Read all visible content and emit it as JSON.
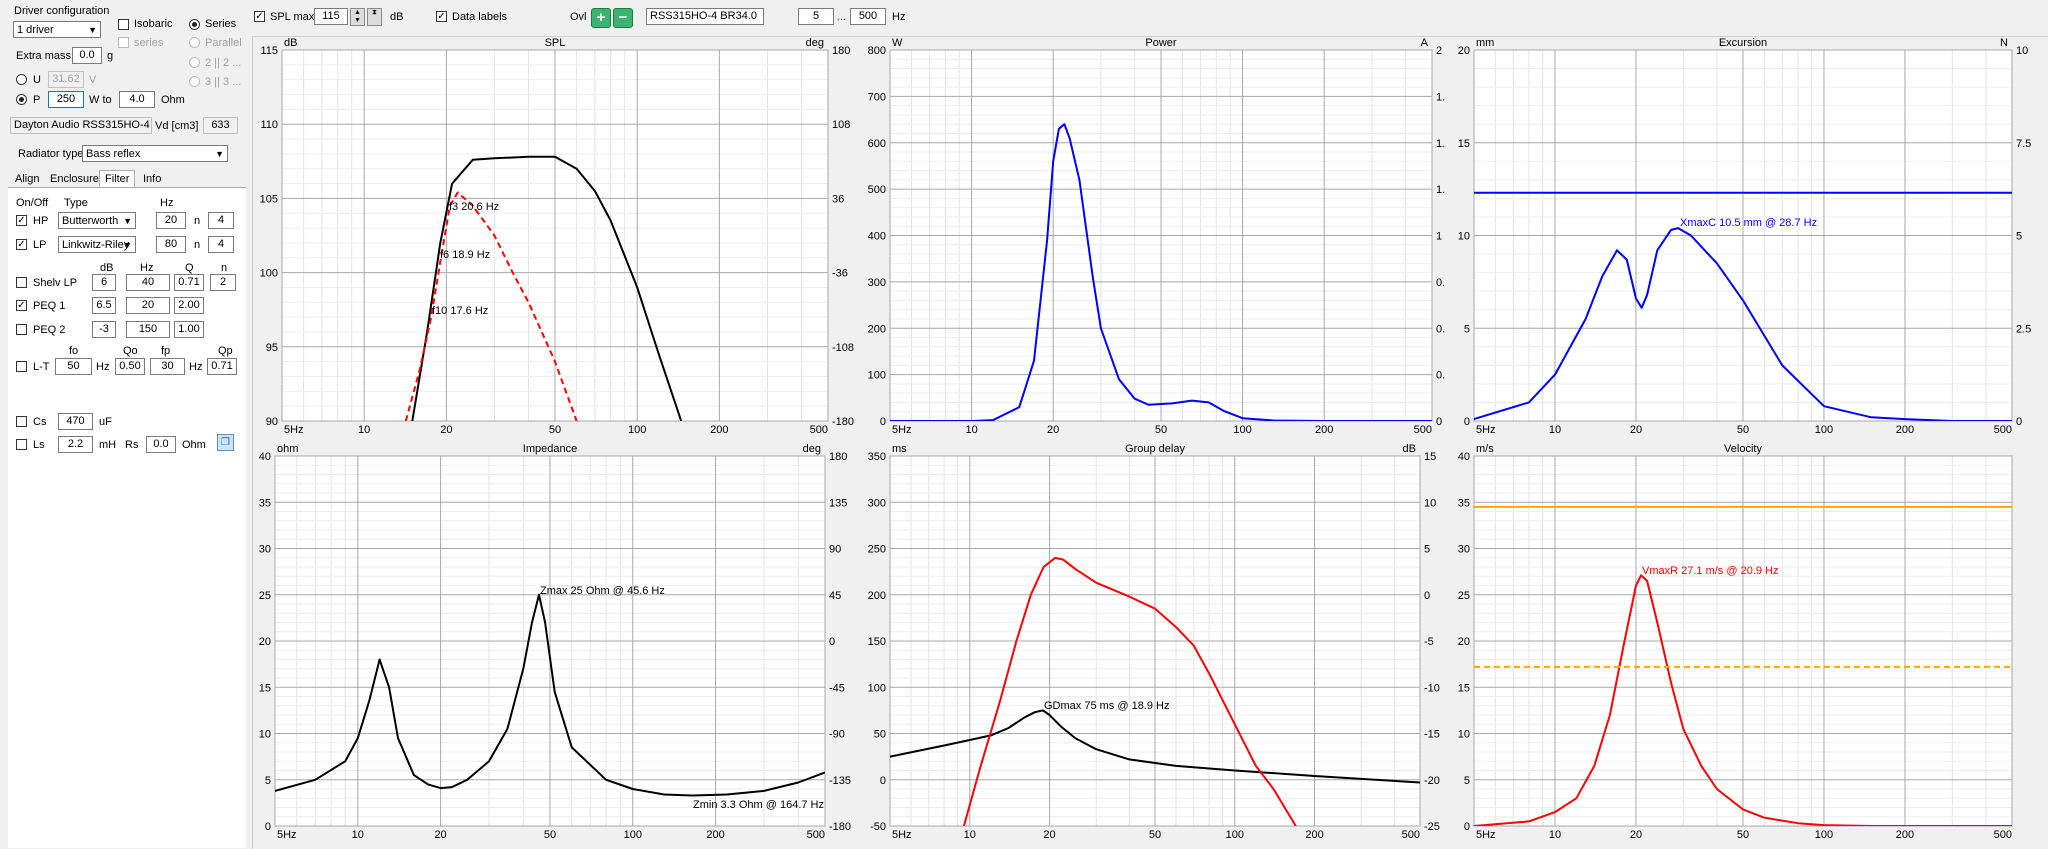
{
  "left_panel": {
    "driver_config_title": "Driver configuration",
    "driver_count": "1 driver",
    "isobaric": "Isobaric",
    "series": "Series",
    "series_small": "series",
    "parallel": "Parallel",
    "par1": "2 || 2 ...",
    "par2": "3 || 3 ...",
    "extra_mass_label": "Extra mass",
    "extra_mass": "0.0",
    "extra_mass_unit": "g",
    "u_label": "U",
    "u_value": "31.62",
    "u_unit": "V",
    "p_label": "P",
    "p_value": "250",
    "w_to": "W to",
    "ohm_value": "4.0",
    "ohm_unit": "Ohm",
    "driver_name": "Dayton Audio RSS315HO-4",
    "vd_label": "Vd [cm3]",
    "vd_value": "633",
    "radiator_label": "Radiator type",
    "radiator_value": "Bass reflex",
    "tabs": [
      "Align",
      "Enclosure",
      "Filter",
      "Info"
    ],
    "filter": {
      "onoff": "On/Off",
      "type": "Type",
      "hz": "Hz",
      "hp_label": "HP",
      "hp_type": "Butterworth",
      "hp_hz": "20",
      "hp_n_label": "n",
      "hp_n": "4",
      "lp_label": "LP",
      "lp_type": "Linkwitz-Riley",
      "lp_hz": "80",
      "lp_n_label": "n",
      "lp_n": "4",
      "db_head": "dB",
      "hz_head": "Hz",
      "q_head": "Q",
      "n_head": "n",
      "shelv_label": "Shelv LP",
      "shelv_db": "6",
      "shelv_hz": "40",
      "shelv_q": "0.71",
      "shelv_n": "2",
      "peq1_label": "PEQ 1",
      "peq1_db": "6.5",
      "peq1_hz": "20",
      "peq1_q": "2.00",
      "peq2_label": "PEQ 2",
      "peq2_db": "-3",
      "peq2_hz": "150",
      "peq2_q": "1.00",
      "fo": "fo",
      "qo": "Qo",
      "fp": "fp",
      "qp": "Qp",
      "lt_label": "L-T",
      "lt_fo": "50",
      "lt_fo_unit": "Hz",
      "lt_qo": "0.50",
      "lt_fp": "30",
      "lt_fp_unit": "Hz",
      "lt_qp": "0.71",
      "cs_label": "Cs",
      "cs_value": "470",
      "cs_unit": "uF",
      "ls_label": "Ls",
      "ls_value": "2.2",
      "ls_unit": "mH",
      "rs_label": "Rs",
      "rs_value": "0.0",
      "rs_unit": "Ohm"
    }
  },
  "toolbar": {
    "spl_max_label": "SPL max",
    "spl_max_value": "115",
    "spl_unit": "dB",
    "data_labels": "Data labels",
    "ovl_label": "Ovl",
    "ovl_name": "RSS315HO-4 BR34.0",
    "f_min": "5",
    "f_sep": "...",
    "f_max": "500",
    "f_unit": "Hz"
  },
  "x_ticks": [
    "5Hz",
    "10",
    "20",
    "50",
    "100",
    "200",
    "500"
  ],
  "charts": {
    "spl": {
      "title": "SPL",
      "left_unit": "dB",
      "right_unit": "deg",
      "left_ticks": [
        "115",
        "110",
        "105",
        "100",
        "95",
        "90"
      ],
      "right_ticks": [
        "180",
        "108",
        "36",
        "-36",
        "-108",
        "-180"
      ],
      "labels": [
        "f3 20.6 Hz",
        "f6 18.9 Hz",
        "f10 17.6 Hz"
      ]
    },
    "power": {
      "title": "Power",
      "left_unit": "W",
      "right_unit": "A",
      "left_ticks": [
        "800",
        "700",
        "600",
        "500",
        "400",
        "300",
        "200",
        "100",
        "0"
      ],
      "right_ticks": [
        "2",
        "1.",
        "1.",
        "1.",
        "1",
        "0.",
        "0.",
        "0.",
        "0"
      ]
    },
    "excursion": {
      "title": "Excursion",
      "left_unit": "mm",
      "right_unit": "N",
      "left_ticks": [
        "20",
        "15",
        "10",
        "5",
        "0"
      ],
      "right_ticks": [
        "10",
        "7.5",
        "5",
        "2.5",
        "0"
      ],
      "label": "XmaxC 10.5 mm  @ 28.7 Hz"
    },
    "impedance": {
      "title": "Impedance",
      "left_unit": "ohm",
      "right_unit": "deg",
      "left_ticks": [
        "40",
        "35",
        "30",
        "25",
        "20",
        "15",
        "10",
        "5",
        "0"
      ],
      "right_ticks": [
        "180",
        "135",
        "90",
        "45",
        "0",
        "-45",
        "-90",
        "-135",
        "-180"
      ],
      "label_max": "Zmax 25 Ohm @ 45.6 Hz",
      "label_min": "Zmin 3.3 Ohm @ 164.7 Hz"
    },
    "group_delay": {
      "title": "Group delay",
      "left_unit": "ms",
      "right_unit": "dB",
      "left_ticks": [
        "350",
        "300",
        "250",
        "200",
        "150",
        "100",
        "50",
        "0",
        "-50"
      ],
      "right_ticks": [
        "15",
        "10",
        "5",
        "0",
        "-5",
        "-10",
        "-15",
        "-20",
        "-25"
      ],
      "label": "GDmax 75 ms  @ 18.9 Hz"
    },
    "velocity": {
      "title": "Velocity",
      "left_unit": "m/s",
      "left_ticks": [
        "40",
        "35",
        "30",
        "25",
        "20",
        "15",
        "10",
        "5",
        "0"
      ],
      "label": "VmaxR 27.1 m/s @ 20.9 Hz"
    }
  },
  "chart_data": [
    {
      "type": "line",
      "title": "SPL",
      "xlabel": "Hz",
      "ylabel": "dB",
      "xscale": "log",
      "xlim": [
        5,
        500
      ],
      "ylim": [
        90,
        115
      ],
      "series": [
        {
          "x": [
            15,
            17,
            19,
            21,
            25,
            30,
            40,
            50,
            60,
            70,
            80,
            100,
            120,
            145
          ],
          "values": [
            90,
            96,
            102,
            106,
            107.6,
            107.7,
            107.8,
            107.8,
            107,
            105.5,
            103.5,
            99,
            94.5,
            90
          ],
          "color": "#000000"
        },
        {
          "x": [
            14.2,
            16,
            17.6,
            18.9,
            20.6,
            22,
            25,
            30,
            35,
            40,
            50,
            60
          ],
          "values": [
            90,
            93.5,
            97,
            100.5,
            104.5,
            105.4,
            104.5,
            102.5,
            100,
            98,
            94,
            90
          ],
          "color": "#ff0000",
          "dashed": true
        }
      ]
    },
    {
      "type": "line",
      "title": "Power",
      "xlabel": "Hz",
      "ylabel": "W",
      "xscale": "log",
      "xlim": [
        5,
        500
      ],
      "ylim": [
        0,
        800
      ],
      "series": [
        {
          "x": [
            5,
            10,
            12,
            15,
            17,
            19,
            20,
            21,
            22,
            23,
            25,
            28,
            30,
            35,
            40,
            45,
            55,
            65,
            75,
            85,
            100,
            130,
            200,
            500
          ],
          "values": [
            0,
            0,
            2,
            30,
            130,
            390,
            560,
            630,
            640,
            610,
            520,
            310,
            200,
            90,
            48,
            35,
            38,
            44,
            40,
            22,
            6,
            1,
            0,
            0
          ],
          "color": "#0000ff"
        }
      ]
    },
    {
      "type": "line",
      "title": "Excursion",
      "xlabel": "Hz",
      "ylabel": "mm",
      "xscale": "log",
      "xlim": [
        5,
        500
      ],
      "ylim": [
        0,
        20
      ],
      "series": [
        {
          "x": [
            5,
            8,
            10,
            13,
            15,
            17,
            18.5,
            20,
            21,
            22,
            24,
            27,
            28.7,
            32,
            40,
            50,
            70,
            100,
            150,
            200,
            300,
            500
          ],
          "values": [
            0.1,
            1,
            2.5,
            5.5,
            7.8,
            9.2,
            8.7,
            6.6,
            6.1,
            6.8,
            9.2,
            10.3,
            10.4,
            10,
            8.5,
            6.5,
            3,
            0.8,
            0.2,
            0.1,
            0,
            0
          ],
          "color": "#0000ff"
        },
        {
          "x": [
            5,
            500
          ],
          "values": [
            12.3,
            12.3
          ],
          "color": "#0000ff"
        }
      ]
    },
    {
      "type": "line",
      "title": "Impedance",
      "xlabel": "Hz",
      "ylabel": "ohm",
      "xscale": "log",
      "xlim": [
        5,
        500
      ],
      "ylim": [
        0,
        40
      ],
      "series": [
        {
          "x": [
            5,
            7,
            9,
            10,
            11,
            12,
            13,
            14,
            16,
            18,
            20,
            22,
            25,
            30,
            35,
            40,
            43,
            45.6,
            48,
            52,
            60,
            80,
            100,
            130,
            164.7,
            220,
            300,
            400,
            500
          ],
          "values": [
            3.8,
            5,
            7,
            9.5,
            13.5,
            18,
            15,
            9.5,
            5.5,
            4.5,
            4.1,
            4.2,
            5,
            7,
            10.5,
            17,
            22,
            25,
            22,
            14.5,
            8.5,
            5,
            4,
            3.4,
            3.3,
            3.4,
            3.8,
            4.7,
            5.8
          ],
          "color": "#000000"
        }
      ]
    },
    {
      "type": "line",
      "title": "Group delay",
      "xlabel": "Hz",
      "ylabel": "ms",
      "xscale": "log",
      "xlim": [
        5,
        500
      ],
      "ylim": [
        -50,
        350
      ],
      "series": [
        {
          "x": [
            5,
            8,
            10,
            12,
            14,
            16,
            17.6,
            18.9,
            20,
            22,
            25,
            30,
            40,
            60,
            100,
            200,
            500
          ],
          "values": [
            25,
            37,
            43,
            48,
            56,
            67,
            73,
            75,
            70,
            58,
            45,
            33,
            22,
            15,
            10,
            4,
            -3
          ],
          "color": "#000000"
        },
        {
          "x": [
            9.5,
            11,
            13,
            15,
            17,
            19,
            21,
            22.5,
            25,
            30,
            40,
            50,
            60,
            70,
            80,
            100,
            120,
            140,
            170
          ],
          "values": [
            -50,
            15,
            85,
            150,
            200,
            230,
            240,
            238,
            228,
            213,
            198,
            185,
            165,
            145,
            115,
            60,
            15,
            -10,
            -50
          ],
          "color": "#ff0000"
        }
      ]
    },
    {
      "type": "line",
      "title": "Velocity",
      "xlabel": "Hz",
      "ylabel": "m/s",
      "xscale": "log",
      "xlim": [
        5,
        500
      ],
      "ylim": [
        0,
        40
      ],
      "series": [
        {
          "x": [
            5,
            8,
            10,
            12,
            14,
            16,
            18,
            20,
            20.9,
            22,
            24,
            27,
            30,
            35,
            40,
            50,
            60,
            80,
            100,
            150,
            200,
            300,
            500
          ],
          "values": [
            0,
            0.5,
            1.5,
            3,
            6.5,
            12,
            19.5,
            26,
            27.1,
            26.5,
            22,
            15.5,
            10.5,
            6.5,
            4,
            1.8,
            0.9,
            0.3,
            0.1,
            0,
            0,
            0,
            0
          ],
          "color": "#ff0000"
        },
        {
          "x": [
            5,
            500
          ],
          "values": [
            34.5,
            34.5
          ],
          "color": "#ffa500"
        },
        {
          "x": [
            5,
            500
          ],
          "values": [
            17.2,
            17.2
          ],
          "color": "#ffa500",
          "dashed": true
        }
      ]
    }
  ]
}
